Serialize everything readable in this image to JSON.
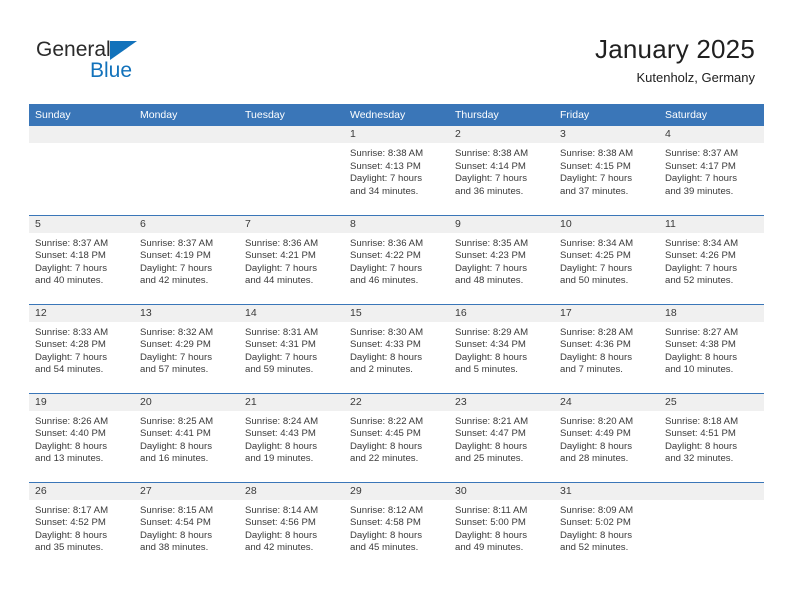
{
  "brand": {
    "name_part1": "General",
    "name_part2": "Blue",
    "triangle_icon": "blue-triangle-icon",
    "colors": {
      "dark": "#2b2b2b",
      "blue": "#1272bb"
    }
  },
  "header": {
    "title": "January 2025",
    "location": "Kutenholz, Germany"
  },
  "theme": {
    "header_band": "#3a76b8",
    "date_strip": "#f0f0f0",
    "text": "#3a3a3a"
  },
  "weekday_headers": [
    "Sunday",
    "Monday",
    "Tuesday",
    "Wednesday",
    "Thursday",
    "Friday",
    "Saturday"
  ],
  "weeks": [
    [
      {
        "day": "",
        "lines": ""
      },
      {
        "day": "",
        "lines": ""
      },
      {
        "day": "",
        "lines": ""
      },
      {
        "day": "1",
        "lines": "Sunrise: 8:38 AM\nSunset: 4:13 PM\nDaylight: 7 hours\nand 34 minutes."
      },
      {
        "day": "2",
        "lines": "Sunrise: 8:38 AM\nSunset: 4:14 PM\nDaylight: 7 hours\nand 36 minutes."
      },
      {
        "day": "3",
        "lines": "Sunrise: 8:38 AM\nSunset: 4:15 PM\nDaylight: 7 hours\nand 37 minutes."
      },
      {
        "day": "4",
        "lines": "Sunrise: 8:37 AM\nSunset: 4:17 PM\nDaylight: 7 hours\nand 39 minutes."
      }
    ],
    [
      {
        "day": "5",
        "lines": "Sunrise: 8:37 AM\nSunset: 4:18 PM\nDaylight: 7 hours\nand 40 minutes."
      },
      {
        "day": "6",
        "lines": "Sunrise: 8:37 AM\nSunset: 4:19 PM\nDaylight: 7 hours\nand 42 minutes."
      },
      {
        "day": "7",
        "lines": "Sunrise: 8:36 AM\nSunset: 4:21 PM\nDaylight: 7 hours\nand 44 minutes."
      },
      {
        "day": "8",
        "lines": "Sunrise: 8:36 AM\nSunset: 4:22 PM\nDaylight: 7 hours\nand 46 minutes."
      },
      {
        "day": "9",
        "lines": "Sunrise: 8:35 AM\nSunset: 4:23 PM\nDaylight: 7 hours\nand 48 minutes."
      },
      {
        "day": "10",
        "lines": "Sunrise: 8:34 AM\nSunset: 4:25 PM\nDaylight: 7 hours\nand 50 minutes."
      },
      {
        "day": "11",
        "lines": "Sunrise: 8:34 AM\nSunset: 4:26 PM\nDaylight: 7 hours\nand 52 minutes."
      }
    ],
    [
      {
        "day": "12",
        "lines": "Sunrise: 8:33 AM\nSunset: 4:28 PM\nDaylight: 7 hours\nand 54 minutes."
      },
      {
        "day": "13",
        "lines": "Sunrise: 8:32 AM\nSunset: 4:29 PM\nDaylight: 7 hours\nand 57 minutes."
      },
      {
        "day": "14",
        "lines": "Sunrise: 8:31 AM\nSunset: 4:31 PM\nDaylight: 7 hours\nand 59 minutes."
      },
      {
        "day": "15",
        "lines": "Sunrise: 8:30 AM\nSunset: 4:33 PM\nDaylight: 8 hours\nand 2 minutes."
      },
      {
        "day": "16",
        "lines": "Sunrise: 8:29 AM\nSunset: 4:34 PM\nDaylight: 8 hours\nand 5 minutes."
      },
      {
        "day": "17",
        "lines": "Sunrise: 8:28 AM\nSunset: 4:36 PM\nDaylight: 8 hours\nand 7 minutes."
      },
      {
        "day": "18",
        "lines": "Sunrise: 8:27 AM\nSunset: 4:38 PM\nDaylight: 8 hours\nand 10 minutes."
      }
    ],
    [
      {
        "day": "19",
        "lines": "Sunrise: 8:26 AM\nSunset: 4:40 PM\nDaylight: 8 hours\nand 13 minutes."
      },
      {
        "day": "20",
        "lines": "Sunrise: 8:25 AM\nSunset: 4:41 PM\nDaylight: 8 hours\nand 16 minutes."
      },
      {
        "day": "21",
        "lines": "Sunrise: 8:24 AM\nSunset: 4:43 PM\nDaylight: 8 hours\nand 19 minutes."
      },
      {
        "day": "22",
        "lines": "Sunrise: 8:22 AM\nSunset: 4:45 PM\nDaylight: 8 hours\nand 22 minutes."
      },
      {
        "day": "23",
        "lines": "Sunrise: 8:21 AM\nSunset: 4:47 PM\nDaylight: 8 hours\nand 25 minutes."
      },
      {
        "day": "24",
        "lines": "Sunrise: 8:20 AM\nSunset: 4:49 PM\nDaylight: 8 hours\nand 28 minutes."
      },
      {
        "day": "25",
        "lines": "Sunrise: 8:18 AM\nSunset: 4:51 PM\nDaylight: 8 hours\nand 32 minutes."
      }
    ],
    [
      {
        "day": "26",
        "lines": "Sunrise: 8:17 AM\nSunset: 4:52 PM\nDaylight: 8 hours\nand 35 minutes."
      },
      {
        "day": "27",
        "lines": "Sunrise: 8:15 AM\nSunset: 4:54 PM\nDaylight: 8 hours\nand 38 minutes."
      },
      {
        "day": "28",
        "lines": "Sunrise: 8:14 AM\nSunset: 4:56 PM\nDaylight: 8 hours\nand 42 minutes."
      },
      {
        "day": "29",
        "lines": "Sunrise: 8:12 AM\nSunset: 4:58 PM\nDaylight: 8 hours\nand 45 minutes."
      },
      {
        "day": "30",
        "lines": "Sunrise: 8:11 AM\nSunset: 5:00 PM\nDaylight: 8 hours\nand 49 minutes."
      },
      {
        "day": "31",
        "lines": "Sunrise: 8:09 AM\nSunset: 5:02 PM\nDaylight: 8 hours\nand 52 minutes."
      },
      {
        "day": "",
        "lines": ""
      }
    ]
  ]
}
